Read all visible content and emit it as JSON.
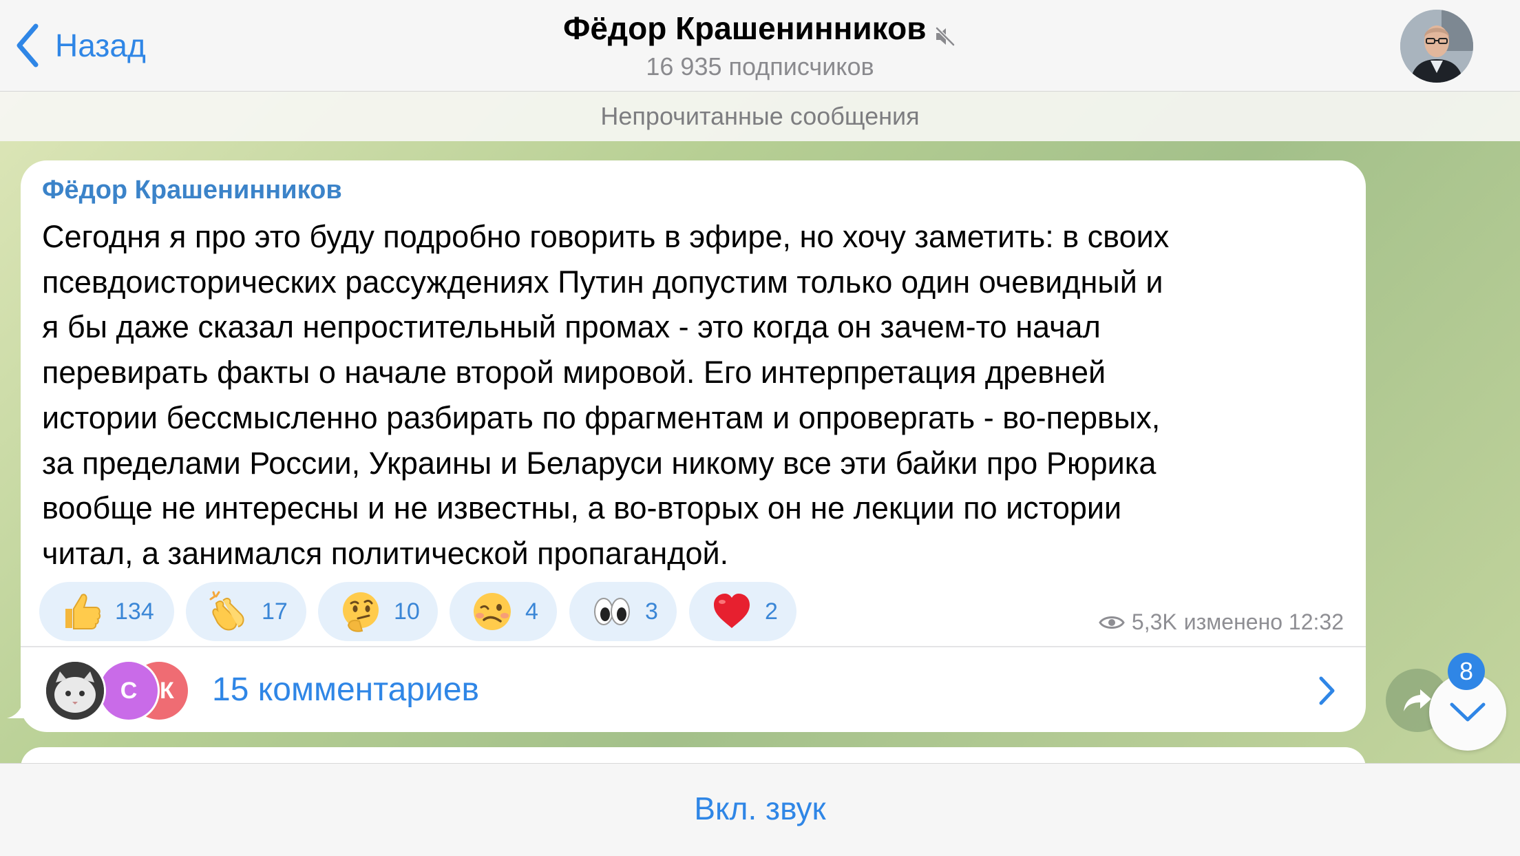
{
  "header": {
    "back_label": "Назад",
    "title": "Фёдор Крашенинников",
    "subscribers": "16 935 подписчиков",
    "muted": true
  },
  "chat": {
    "unread_divider": "Непрочитанные сообщения",
    "message": {
      "sender": "Фёдор Крашенинников",
      "text_lines": [
        "Сегодня я про это буду подробно говорить в эфире, но хочу заметить: в своих",
        "псевдоисторических рассуждениях Путин допустим только один очевидный и",
        "я бы даже сказал непростительный промах - это когда он зачем-то начал",
        "перевирать факты о начале второй мировой. Его интерпретация древней",
        "истории бессмысленно разбирать по фрагментам и опровергать - во-первых,",
        "за пределами России, Украины и Беларуси никому все эти байки про Рюрика",
        "вообще не интересны и не известны, а во-вторых он не лекции по истории",
        "читал, а занимался политической пропагандой."
      ],
      "reactions": [
        {
          "emoji": "thumbs-up",
          "count": "134"
        },
        {
          "emoji": "clapping-hands",
          "count": "17"
        },
        {
          "emoji": "thinking-face",
          "count": "10"
        },
        {
          "emoji": "woozy-face",
          "count": "4"
        },
        {
          "emoji": "eyes",
          "count": "3"
        },
        {
          "emoji": "red-heart",
          "count": "2"
        }
      ],
      "views": "5,3K",
      "edited_time": "изменено 12:32",
      "comments": {
        "label": "15 комментариев",
        "avatars": [
          "",
          "С",
          "ЕК"
        ]
      }
    },
    "unread_count": "8"
  },
  "bottom": {
    "unmute_label": "Вкл. звук"
  },
  "colors": {
    "accent": "#2f86e6",
    "sender": "#3b83c9",
    "reaction_bg": "#e5f0fb"
  }
}
